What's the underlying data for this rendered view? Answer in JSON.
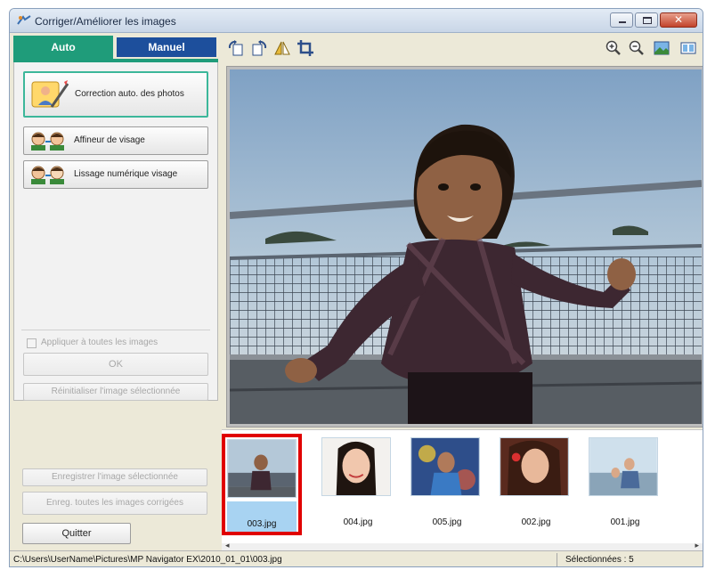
{
  "window": {
    "title": "Corriger/Améliorer les images"
  },
  "tabs": {
    "auto": "Auto",
    "manual": "Manuel"
  },
  "left_panel": {
    "auto_fix_label": "Correction auto. des photos",
    "face_sharpen_label": "Affineur de visage",
    "face_smooth_label": "Lissage numérique visage",
    "apply_all_label": "Appliquer à toutes les images",
    "apply_all_checked": false,
    "ok_label": "OK",
    "reset_label": "Réinitialiser l'image sélectionnée",
    "save_selected_label": "Enregistrer l'image sélectionnée",
    "save_all_label": "Enreg. toutes les images corrigées",
    "quit_label": "Quitter"
  },
  "toolbar": {
    "left_icons": [
      "rotate-left-icon",
      "rotate-right-icon",
      "flip-icon",
      "crop-icon"
    ],
    "right_icons": [
      "zoom-in-icon",
      "zoom-out-icon",
      "full-image-icon",
      "compare-icon"
    ]
  },
  "thumbnails": [
    {
      "name": "003.jpg",
      "selected": true
    },
    {
      "name": "004.jpg",
      "selected": false
    },
    {
      "name": "005.jpg",
      "selected": false
    },
    {
      "name": "002.jpg",
      "selected": false
    },
    {
      "name": "001.jpg",
      "selected": false
    }
  ],
  "status": {
    "path": "C:\\Users\\UserName\\Pictures\\MP Navigator EX\\2010_01_01\\003.jpg",
    "selected_count": "Sélectionnées : 5"
  },
  "colors": {
    "auto_tab": "#1f9c7a",
    "manual_tab": "#1d4f9c",
    "selection_border": "#e00000"
  }
}
